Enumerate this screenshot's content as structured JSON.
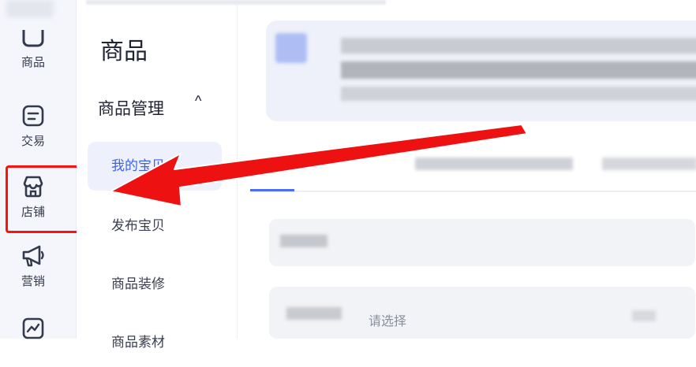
{
  "sidebar": {
    "items": [
      {
        "label": "商品",
        "icon": "bag-icon"
      },
      {
        "label": "交易",
        "icon": "document-icon"
      },
      {
        "label": "店铺",
        "icon": "store-icon"
      },
      {
        "label": "营销",
        "icon": "megaphone-icon"
      },
      {
        "label": "",
        "icon": "chart-icon"
      }
    ]
  },
  "submenu": {
    "title": "商品",
    "group_label": "商品管理",
    "group_chevron": "^",
    "items": [
      {
        "label": "我的宝贝",
        "active": true
      },
      {
        "label": "发布宝贝",
        "active": false
      },
      {
        "label": "商品装修",
        "active": false
      },
      {
        "label": "商品素材",
        "active": false
      }
    ]
  },
  "main": {
    "select_placeholder": "请选择"
  },
  "annotations": {
    "highlight_color": "#ff1010",
    "arrow_color": "#ee1111"
  }
}
